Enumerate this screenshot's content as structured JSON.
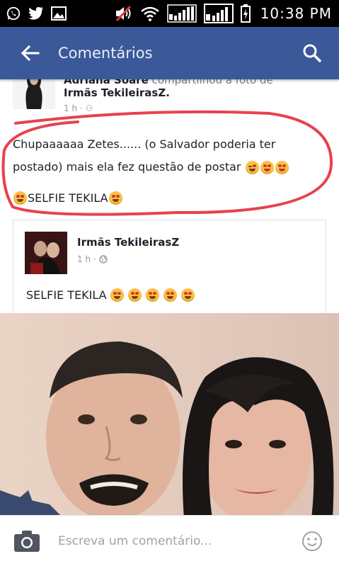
{
  "status_bar": {
    "time": "10:38 PM",
    "icons": [
      "whatsapp-icon",
      "twitter-icon",
      "gallery-icon",
      "mute-icon",
      "wifi-icon",
      "signal-icon",
      "signal-icon",
      "battery-charging-icon"
    ]
  },
  "app_bar": {
    "title": "Comentários",
    "back_icon": "arrow-left-icon",
    "search_icon": "search-icon",
    "color": "#3b5998"
  },
  "post": {
    "author": "Adriana Soare",
    "action": "compartilhou a foto de",
    "page": "Irmãs TekileirasZ.",
    "meta": "1 h",
    "text": "Chupaaaaaa Zetes...... (o Salvador poderia ter postado) mais ela fez questão de postar",
    "selfie_caption": "SELFIE TEKILA"
  },
  "shared_post": {
    "name": "Irmãs TekileirasZ",
    "meta": "1 h",
    "text": "SELFIE TEKILA"
  },
  "comment_bar": {
    "placeholder": "Escreva um comentário...",
    "camera_icon": "camera-icon",
    "emoji_icon": "smiley-icon"
  },
  "colors": {
    "highlight_stroke": "#e8424c",
    "status_bar": "#000000"
  }
}
